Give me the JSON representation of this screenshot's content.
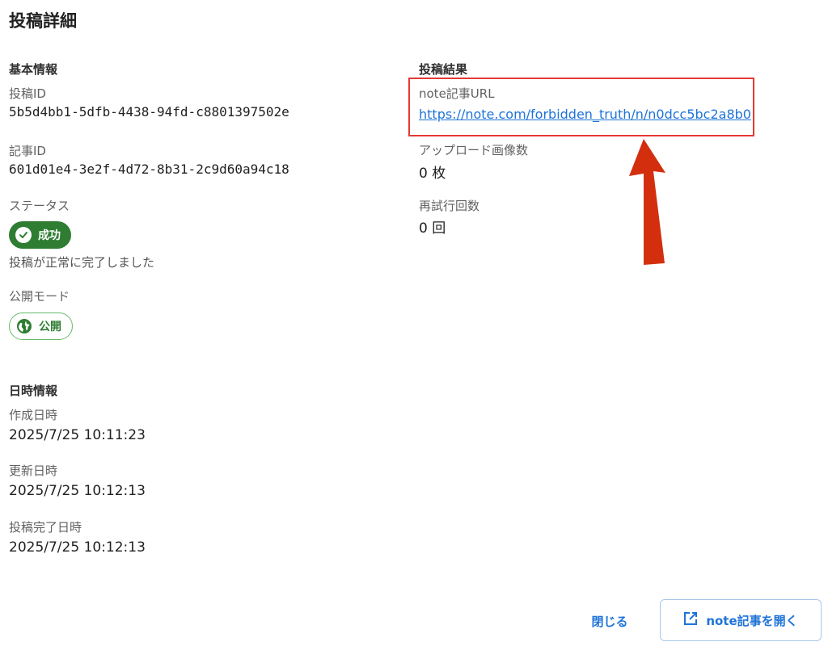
{
  "dialog": {
    "title": "投稿詳細",
    "basic_info": {
      "heading": "基本情報",
      "post_id_label": "投稿ID",
      "post_id_value": "5b5d4bb1-5dfb-4438-94fd-c8801397502e",
      "article_id_label": "記事ID",
      "article_id_value": "601d01e4-3e2f-4d72-8b31-2c9d60a94c18",
      "status_label": "ステータス",
      "status_chip": "成功",
      "status_message": "投稿が正常に完了しました",
      "visibility_label": "公開モード",
      "visibility_chip": "公開"
    },
    "post_result": {
      "heading": "投稿結果",
      "url_label": "note記事URL",
      "url_value": "https://note.com/forbidden_truth/n/n0dcc5bc2a8b0",
      "uploaded_images_label": "アップロード画像数",
      "uploaded_images_value": "0 枚",
      "retry_count_label": "再試行回数",
      "retry_count_value": "0 回"
    },
    "datetime_info": {
      "heading": "日時情報",
      "created_label": "作成日時",
      "created_value": "2025/7/25 10:11:23",
      "updated_label": "更新日時",
      "updated_value": "2025/7/25 10:12:13",
      "completed_label": "投稿完了日時",
      "completed_value": "2025/7/25 10:12:13"
    },
    "actions": {
      "close_label": "閉じる",
      "open_label": "note記事を開く"
    }
  },
  "colors": {
    "success": "#2e7d32",
    "link": "#1e73d8",
    "highlight": "#e53935",
    "arrow": "#d32f0f"
  },
  "icons": {
    "status": "check-circle-icon",
    "visibility": "globe-icon",
    "open": "open-in-new-icon"
  }
}
